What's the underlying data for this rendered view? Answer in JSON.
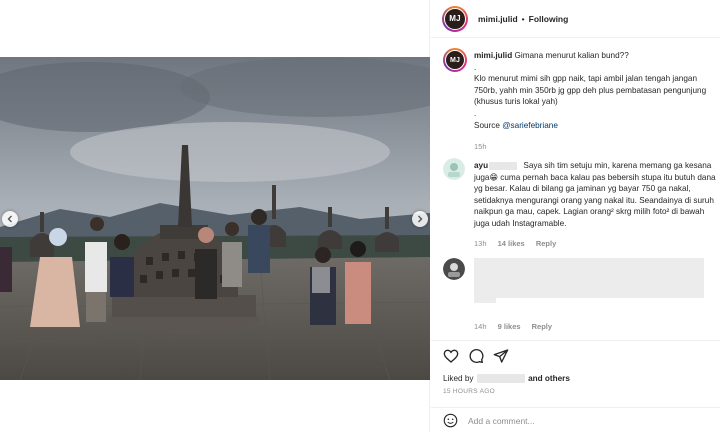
{
  "post": {
    "username": "mimi.julid",
    "follow_status": "Following",
    "avatar_initials": "MJ",
    "caption": {
      "lead": "Gimana menurut kalian bund??",
      "dot1": ".",
      "body": "Klo menurut mimi sih gpp naik, tapi ambil jalan tengah jangan 750rb, yahh min 350rb jg gpp deh plus pembatasan pengunjung (khusus turis lokal yah)",
      "dot2": ".",
      "source_label": "Source",
      "source_handle": "@sariefebriane"
    },
    "caption_time": "15h"
  },
  "comments": [
    {
      "username": "ayu",
      "text": "Saya sih tim setuju min, karena memang ga kesana juga😁 cuma pernah baca kalau pas bebersih stupa itu butuh dana yg besar. Kalau di bilang ga jaminan yg bayar 750 ga nakal, setidaknya mengurangi orang yang nakal itu. Seandainya di suruh naikpun ga mau, capek. Lagian orang² skrg milih foto² di bawah juga udah Instagramable.",
      "time": "13h",
      "likes": "14 likes",
      "reply": "Reply"
    },
    {
      "username": "",
      "text": "",
      "time": "14h",
      "likes": "9 likes",
      "reply": "Reply"
    }
  ],
  "actions": {
    "like_icon": "heart-icon",
    "comment_icon": "comment-icon",
    "share_icon": "paper-plane-icon"
  },
  "likes_line": {
    "prefix": "Liked by",
    "suffix": "and others"
  },
  "time_ago": "15 HOURS AGO",
  "add_comment": {
    "emoji_icon": "smiley-icon",
    "placeholder": "Add a comment..."
  },
  "colors": {
    "link": "#00376b",
    "muted": "#8e8e8e",
    "text": "#262626",
    "ring_start": "#f58529",
    "ring_mid": "#dd2a7b",
    "ring_end": "#8134af"
  }
}
